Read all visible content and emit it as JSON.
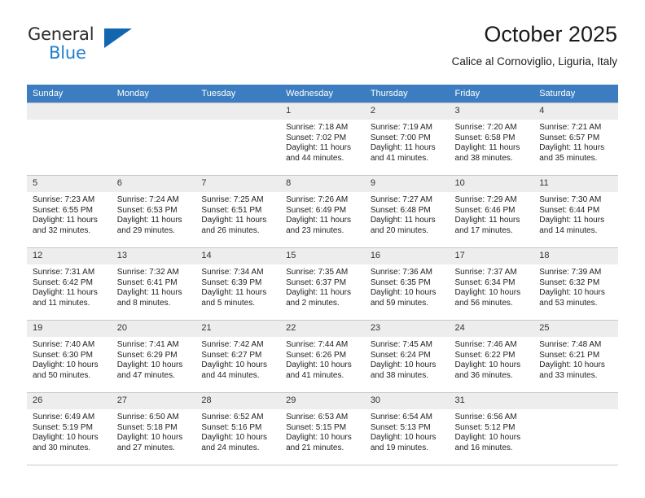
{
  "brand": {
    "name_part1": "General",
    "name_part2": "Blue",
    "accent_color": "#1266b0",
    "blue_text_color": "#1f7fd0"
  },
  "header": {
    "month_title": "October 2025",
    "location": "Calice al Cornoviglio, Liguria, Italy"
  },
  "calendar": {
    "header_bg": "#3b7dc0",
    "daynum_bg": "#ededed",
    "weekday_headers": [
      "Sunday",
      "Monday",
      "Tuesday",
      "Wednesday",
      "Thursday",
      "Friday",
      "Saturday"
    ],
    "weeks": [
      [
        {
          "day": "",
          "sunrise": "",
          "sunset": "",
          "daylight_line1": "",
          "daylight_line2": ""
        },
        {
          "day": "",
          "sunrise": "",
          "sunset": "",
          "daylight_line1": "",
          "daylight_line2": ""
        },
        {
          "day": "",
          "sunrise": "",
          "sunset": "",
          "daylight_line1": "",
          "daylight_line2": ""
        },
        {
          "day": "1",
          "sunrise": "Sunrise: 7:18 AM",
          "sunset": "Sunset: 7:02 PM",
          "daylight_line1": "Daylight: 11 hours",
          "daylight_line2": "and 44 minutes."
        },
        {
          "day": "2",
          "sunrise": "Sunrise: 7:19 AM",
          "sunset": "Sunset: 7:00 PM",
          "daylight_line1": "Daylight: 11 hours",
          "daylight_line2": "and 41 minutes."
        },
        {
          "day": "3",
          "sunrise": "Sunrise: 7:20 AM",
          "sunset": "Sunset: 6:58 PM",
          "daylight_line1": "Daylight: 11 hours",
          "daylight_line2": "and 38 minutes."
        },
        {
          "day": "4",
          "sunrise": "Sunrise: 7:21 AM",
          "sunset": "Sunset: 6:57 PM",
          "daylight_line1": "Daylight: 11 hours",
          "daylight_line2": "and 35 minutes."
        }
      ],
      [
        {
          "day": "5",
          "sunrise": "Sunrise: 7:23 AM",
          "sunset": "Sunset: 6:55 PM",
          "daylight_line1": "Daylight: 11 hours",
          "daylight_line2": "and 32 minutes."
        },
        {
          "day": "6",
          "sunrise": "Sunrise: 7:24 AM",
          "sunset": "Sunset: 6:53 PM",
          "daylight_line1": "Daylight: 11 hours",
          "daylight_line2": "and 29 minutes."
        },
        {
          "day": "7",
          "sunrise": "Sunrise: 7:25 AM",
          "sunset": "Sunset: 6:51 PM",
          "daylight_line1": "Daylight: 11 hours",
          "daylight_line2": "and 26 minutes."
        },
        {
          "day": "8",
          "sunrise": "Sunrise: 7:26 AM",
          "sunset": "Sunset: 6:49 PM",
          "daylight_line1": "Daylight: 11 hours",
          "daylight_line2": "and 23 minutes."
        },
        {
          "day": "9",
          "sunrise": "Sunrise: 7:27 AM",
          "sunset": "Sunset: 6:48 PM",
          "daylight_line1": "Daylight: 11 hours",
          "daylight_line2": "and 20 minutes."
        },
        {
          "day": "10",
          "sunrise": "Sunrise: 7:29 AM",
          "sunset": "Sunset: 6:46 PM",
          "daylight_line1": "Daylight: 11 hours",
          "daylight_line2": "and 17 minutes."
        },
        {
          "day": "11",
          "sunrise": "Sunrise: 7:30 AM",
          "sunset": "Sunset: 6:44 PM",
          "daylight_line1": "Daylight: 11 hours",
          "daylight_line2": "and 14 minutes."
        }
      ],
      [
        {
          "day": "12",
          "sunrise": "Sunrise: 7:31 AM",
          "sunset": "Sunset: 6:42 PM",
          "daylight_line1": "Daylight: 11 hours",
          "daylight_line2": "and 11 minutes."
        },
        {
          "day": "13",
          "sunrise": "Sunrise: 7:32 AM",
          "sunset": "Sunset: 6:41 PM",
          "daylight_line1": "Daylight: 11 hours",
          "daylight_line2": "and 8 minutes."
        },
        {
          "day": "14",
          "sunrise": "Sunrise: 7:34 AM",
          "sunset": "Sunset: 6:39 PM",
          "daylight_line1": "Daylight: 11 hours",
          "daylight_line2": "and 5 minutes."
        },
        {
          "day": "15",
          "sunrise": "Sunrise: 7:35 AM",
          "sunset": "Sunset: 6:37 PM",
          "daylight_line1": "Daylight: 11 hours",
          "daylight_line2": "and 2 minutes."
        },
        {
          "day": "16",
          "sunrise": "Sunrise: 7:36 AM",
          "sunset": "Sunset: 6:35 PM",
          "daylight_line1": "Daylight: 10 hours",
          "daylight_line2": "and 59 minutes."
        },
        {
          "day": "17",
          "sunrise": "Sunrise: 7:37 AM",
          "sunset": "Sunset: 6:34 PM",
          "daylight_line1": "Daylight: 10 hours",
          "daylight_line2": "and 56 minutes."
        },
        {
          "day": "18",
          "sunrise": "Sunrise: 7:39 AM",
          "sunset": "Sunset: 6:32 PM",
          "daylight_line1": "Daylight: 10 hours",
          "daylight_line2": "and 53 minutes."
        }
      ],
      [
        {
          "day": "19",
          "sunrise": "Sunrise: 7:40 AM",
          "sunset": "Sunset: 6:30 PM",
          "daylight_line1": "Daylight: 10 hours",
          "daylight_line2": "and 50 minutes."
        },
        {
          "day": "20",
          "sunrise": "Sunrise: 7:41 AM",
          "sunset": "Sunset: 6:29 PM",
          "daylight_line1": "Daylight: 10 hours",
          "daylight_line2": "and 47 minutes."
        },
        {
          "day": "21",
          "sunrise": "Sunrise: 7:42 AM",
          "sunset": "Sunset: 6:27 PM",
          "daylight_line1": "Daylight: 10 hours",
          "daylight_line2": "and 44 minutes."
        },
        {
          "day": "22",
          "sunrise": "Sunrise: 7:44 AM",
          "sunset": "Sunset: 6:26 PM",
          "daylight_line1": "Daylight: 10 hours",
          "daylight_line2": "and 41 minutes."
        },
        {
          "day": "23",
          "sunrise": "Sunrise: 7:45 AM",
          "sunset": "Sunset: 6:24 PM",
          "daylight_line1": "Daylight: 10 hours",
          "daylight_line2": "and 38 minutes."
        },
        {
          "day": "24",
          "sunrise": "Sunrise: 7:46 AM",
          "sunset": "Sunset: 6:22 PM",
          "daylight_line1": "Daylight: 10 hours",
          "daylight_line2": "and 36 minutes."
        },
        {
          "day": "25",
          "sunrise": "Sunrise: 7:48 AM",
          "sunset": "Sunset: 6:21 PM",
          "daylight_line1": "Daylight: 10 hours",
          "daylight_line2": "and 33 minutes."
        }
      ],
      [
        {
          "day": "26",
          "sunrise": "Sunrise: 6:49 AM",
          "sunset": "Sunset: 5:19 PM",
          "daylight_line1": "Daylight: 10 hours",
          "daylight_line2": "and 30 minutes."
        },
        {
          "day": "27",
          "sunrise": "Sunrise: 6:50 AM",
          "sunset": "Sunset: 5:18 PM",
          "daylight_line1": "Daylight: 10 hours",
          "daylight_line2": "and 27 minutes."
        },
        {
          "day": "28",
          "sunrise": "Sunrise: 6:52 AM",
          "sunset": "Sunset: 5:16 PM",
          "daylight_line1": "Daylight: 10 hours",
          "daylight_line2": "and 24 minutes."
        },
        {
          "day": "29",
          "sunrise": "Sunrise: 6:53 AM",
          "sunset": "Sunset: 5:15 PM",
          "daylight_line1": "Daylight: 10 hours",
          "daylight_line2": "and 21 minutes."
        },
        {
          "day": "30",
          "sunrise": "Sunrise: 6:54 AM",
          "sunset": "Sunset: 5:13 PM",
          "daylight_line1": "Daylight: 10 hours",
          "daylight_line2": "and 19 minutes."
        },
        {
          "day": "31",
          "sunrise": "Sunrise: 6:56 AM",
          "sunset": "Sunset: 5:12 PM",
          "daylight_line1": "Daylight: 10 hours",
          "daylight_line2": "and 16 minutes."
        },
        {
          "day": "",
          "sunrise": "",
          "sunset": "",
          "daylight_line1": "",
          "daylight_line2": ""
        }
      ]
    ]
  }
}
